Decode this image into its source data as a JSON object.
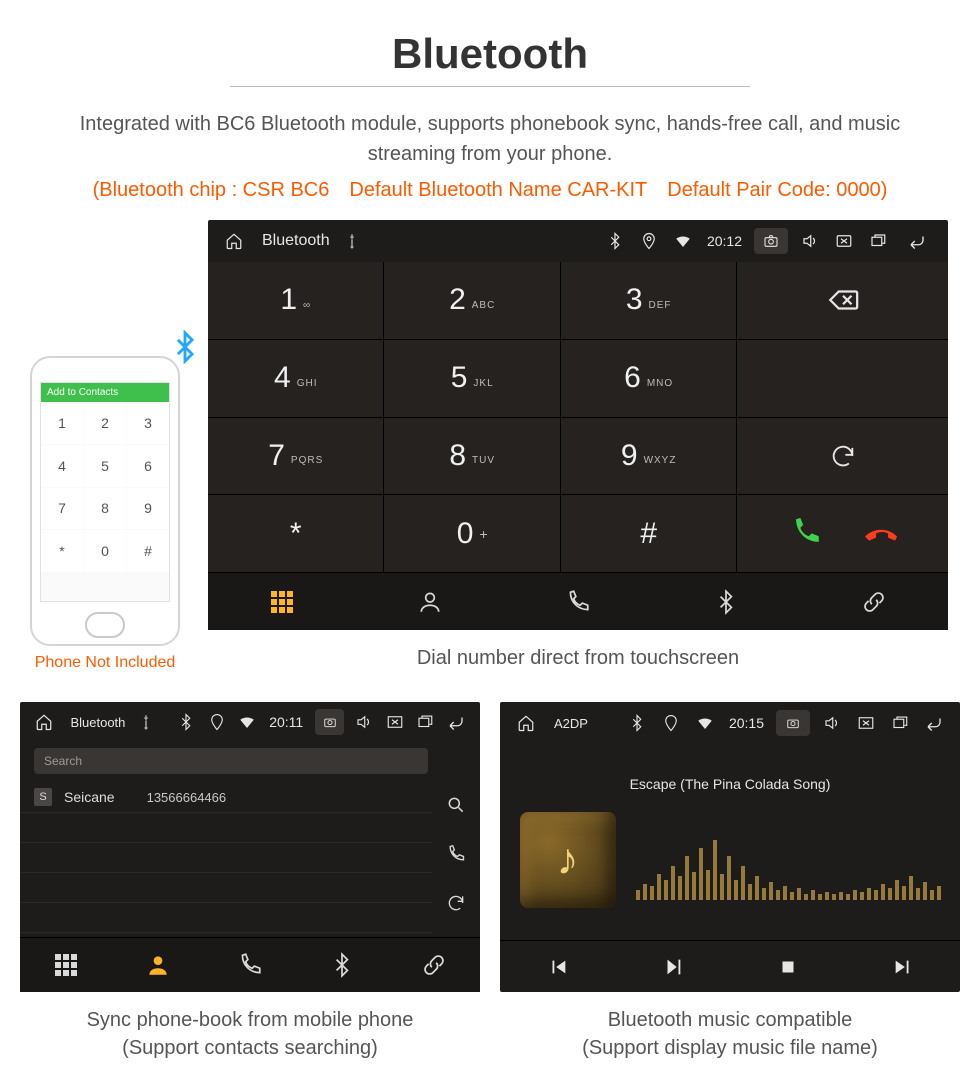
{
  "header": {
    "title": "Bluetooth",
    "desc": "Integrated with BC6 Bluetooth module, supports phonebook sync, hands-free call, and music streaming from your phone.",
    "specs": "(Bluetooth chip : CSR BC6 Default Bluetooth Name CAR-KIT Default Pair Code: 0000)"
  },
  "phone": {
    "header": "Add to Contacts",
    "keys": [
      "1",
      "2",
      "3",
      "4",
      "5",
      "6",
      "7",
      "8",
      "9",
      "*",
      "0",
      "#"
    ],
    "note": "Phone Not Included"
  },
  "dialer": {
    "status": {
      "title": "Bluetooth",
      "time": "20:12"
    },
    "keys": [
      {
        "n": "1",
        "s": "∞"
      },
      {
        "n": "2",
        "s": "ABC"
      },
      {
        "n": "3",
        "s": "DEF"
      },
      {
        "n": "4",
        "s": "GHI"
      },
      {
        "n": "5",
        "s": "JKL"
      },
      {
        "n": "6",
        "s": "MNO"
      },
      {
        "n": "7",
        "s": "PQRS"
      },
      {
        "n": "8",
        "s": "TUV"
      },
      {
        "n": "9",
        "s": "WXYZ"
      },
      {
        "n": "*",
        "s": ""
      },
      {
        "n": "0",
        "sup": "+"
      },
      {
        "n": "#",
        "s": ""
      }
    ],
    "caption": "Dial number direct from touchscreen"
  },
  "contacts": {
    "status": {
      "title": "Bluetooth",
      "time": "20:11"
    },
    "search_placeholder": "Search",
    "rows": [
      {
        "initial": "S",
        "name": "Seicane",
        "phone": "13566664466"
      }
    ],
    "caption_l1": "Sync phone-book from mobile phone",
    "caption_l2": "(Support contacts searching)"
  },
  "music": {
    "status": {
      "title": "A2DP",
      "time": "20:15"
    },
    "song": "Escape (The Pina Colada Song)",
    "eq": [
      10,
      16,
      14,
      26,
      20,
      34,
      24,
      44,
      28,
      52,
      30,
      60,
      26,
      44,
      20,
      34,
      16,
      24,
      12,
      18,
      10,
      14,
      8,
      12,
      6,
      10,
      6,
      8,
      6,
      8,
      6,
      10,
      8,
      12,
      10,
      16,
      12,
      20,
      14,
      24,
      12,
      18,
      10,
      14
    ],
    "caption_l1": "Bluetooth music compatible",
    "caption_l2": "(Support display music file name)"
  }
}
